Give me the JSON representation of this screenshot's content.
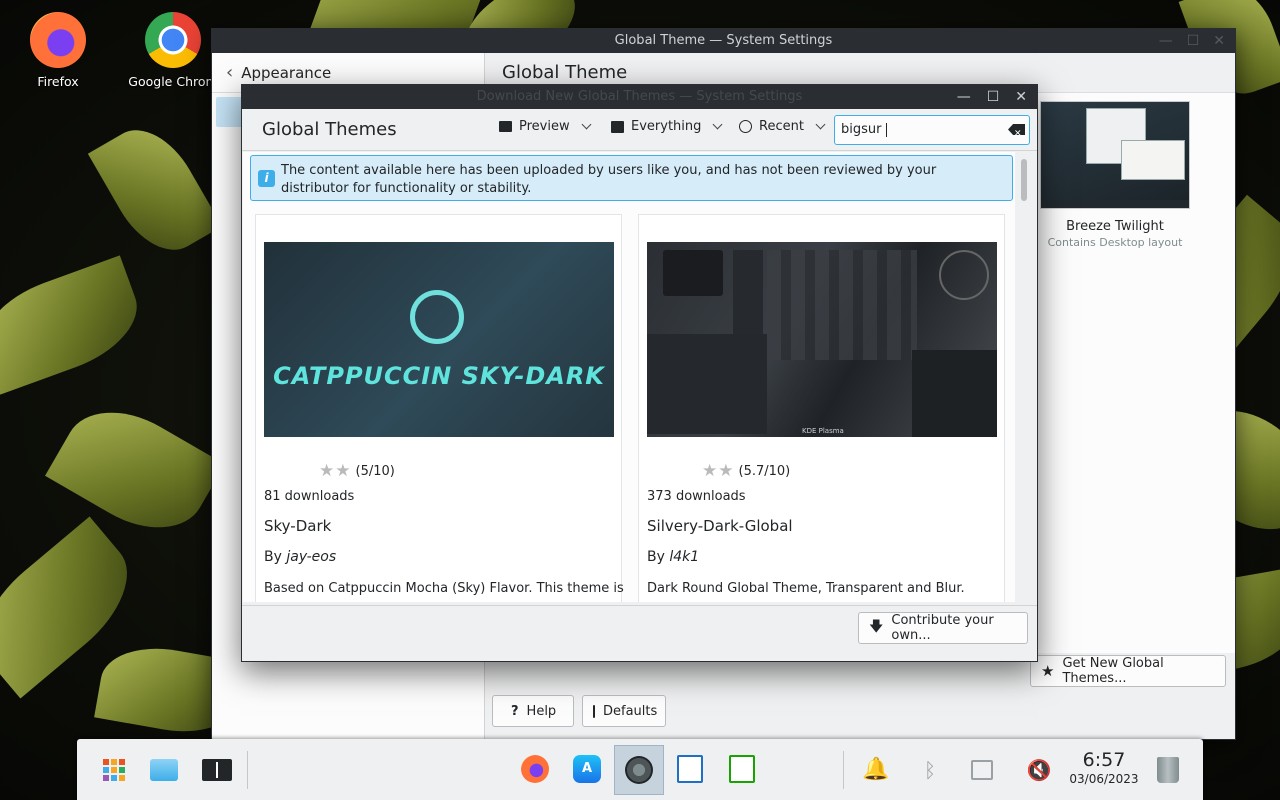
{
  "desktop": {
    "icons": [
      {
        "label": "Firefox"
      },
      {
        "label": "Google Chrom"
      }
    ]
  },
  "back_window": {
    "title": "Global Theme — System Settings",
    "sidebar_header": "Appearance",
    "page_title": "Global Theme",
    "theme_card": {
      "name": "Breeze Twilight",
      "subtitle": "Contains Desktop layout"
    },
    "get_new_label": "Get New Global Themes...",
    "help_label": "Help",
    "defaults_label": "Defaults"
  },
  "dialog": {
    "title": "Download New Global Themes — System Settings",
    "heading": "Global Themes",
    "view_dropdown": "Preview",
    "filter_dropdown": "Everything",
    "sort_dropdown": "Recent",
    "search": {
      "value": "bigsur",
      "placeholder": ""
    },
    "notice": "The content available here has been uploaded by users like you, and has not been reviewed by your distributor for functionality or stability.",
    "items": [
      {
        "rating": "(5/10)",
        "downloads": "81 downloads",
        "name": "Sky-Dark",
        "by": "By",
        "author": "jay-eos",
        "description": "Based on Catppuccin Mocha (Sky) Flavor. This theme is",
        "preview_text": "CATPPUCCIN SKY-DARK"
      },
      {
        "rating": "(5.7/10)",
        "downloads": "373 downloads",
        "name": "Silvery-Dark-Global",
        "by": "By",
        "author": "l4k1",
        "description": "Dark Round Global Theme, Transparent and Blur.",
        "preview_text": "KDE Plasma"
      }
    ],
    "contribute_label": "Contribute your own..."
  },
  "taskbar": {
    "time": "6:57",
    "date": "03/06/2023",
    "icons": [
      "app-launcher-icon",
      "files-icon",
      "overview-icon",
      "firefox-icon",
      "app-store-icon",
      "system-settings-icon",
      "writer-icon",
      "calc-icon",
      "notifications-icon",
      "bluetooth-icon",
      "network-icon",
      "volume-muted-icon",
      "trash-icon"
    ]
  },
  "colors": {
    "accent": "#3daee9",
    "titlebar": "#2a2e32",
    "window_bg": "#eff0f1"
  }
}
